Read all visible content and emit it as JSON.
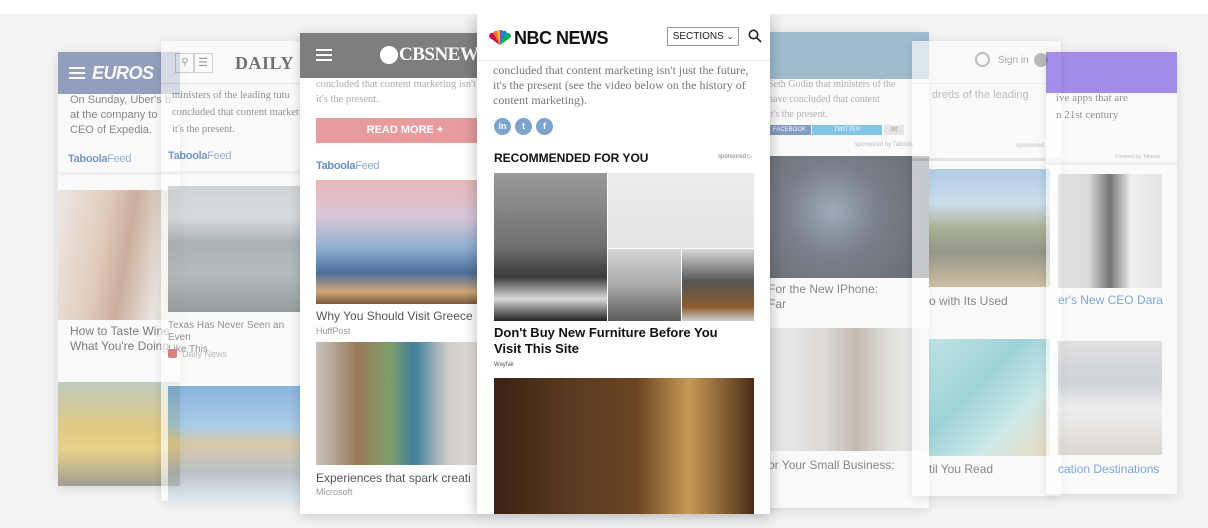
{
  "euro": {
    "logo": "EUROS",
    "body": "On Sunday, Uber's b\nat the company to\nCEO of Expedia.",
    "taboola": "Taboola",
    "feed": "Feed",
    "cap1": "How to Taste Wine\nWhat You're Doing"
  },
  "daily": {
    "logo": "DAILY",
    "body": "ministers of the leading tutu\nconcluded that content marketin\nit's the present.",
    "taboola": "Taboola",
    "feed": "Feed",
    "cap1": "Texas Has Never Seen an Even\nLike This",
    "src1": "Daily News"
  },
  "cbs": {
    "logo": "CBSNEWS",
    "body": "concluded that content marketing isn't\nit's the present.",
    "read_more": "READ MORE +",
    "taboola": "Taboola",
    "feed": "Feed",
    "cap1": "Why You Should Visit Greece",
    "src1": "HuffPost",
    "cap2": "Experiences that spark creati",
    "src2": "Microsoft"
  },
  "nbc": {
    "logo": "NBC NEWS",
    "sections": "SECTIONS",
    "body": "concluded that content marketing isn't just the future, it's the present (see the video below on the history of content marketing).",
    "social": [
      "in",
      "t",
      "f"
    ],
    "recommended": "RECOMMENDED FOR YOU",
    "sponsored": "sponsored",
    "headline": "Don't Buy New Furniture Before You Visit This Site",
    "source": "Wayfair"
  },
  "apple": {
    "body": "Seth Godin that ministers of the\nhave concluded that content\nit's the present.",
    "share1": "FACEBOOK",
    "share2": "TWITTER",
    "sponsored": "sponsored by Taboola",
    "cap1": "For the New IPhone:\nFar",
    "cap2": "or Your Small Business:"
  },
  "signin": {
    "signin": "Sign in",
    "body": "dreds of the leading",
    "sponsored": "sponsored",
    "cap1": "o with Its Used",
    "cap2": "til You Read"
  },
  "purple": {
    "body": "ive apps that are\nn 21st century",
    "powered": "Powered by Taboola",
    "cap1": "er's New CEO Dara",
    "cap2": "cation Destinations"
  }
}
